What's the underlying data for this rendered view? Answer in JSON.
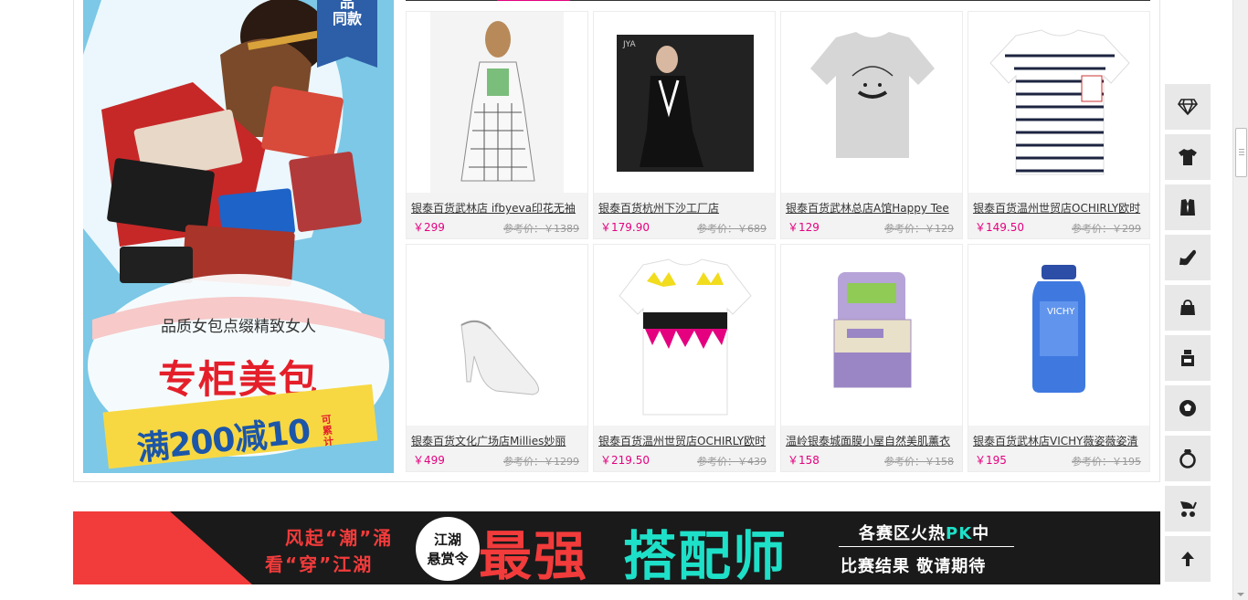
{
  "promo": {
    "badge_line1": "品",
    "badge_line2": "同款",
    "subtitle": "品质女包点缀精致女人",
    "title": "专柜美包",
    "deal": "满200减10",
    "deal_tag": "可累计"
  },
  "products": [
    {
      "name": "银泰百货武林店 ifbyeva印花无袖",
      "price": "￥299",
      "ref_price": "参考价：￥1389"
    },
    {
      "name": "银泰百货杭州下沙工厂店",
      "price": "￥179.90",
      "ref_price": "参考价：￥689"
    },
    {
      "name": "银泰百货武林总店A馆Happy Tee",
      "price": "￥129",
      "ref_price": "参考价：￥129"
    },
    {
      "name": "银泰百货温州世贸店OCHIRLY欧时",
      "price": "￥149.50",
      "ref_price": "参考价：￥299"
    },
    {
      "name": "银泰百货文化广场店Millies妙丽",
      "price": "￥499",
      "ref_price": "参考价：￥1299"
    },
    {
      "name": "银泰百货温州世贸店OCHIRLY欧时",
      "price": "￥219.50",
      "ref_price": "参考价：￥439"
    },
    {
      "name": "温岭银泰城面膜小屋自然美肌薰衣",
      "price": "￥158",
      "ref_price": "参考价：￥158"
    },
    {
      "name": "银泰百货武林店VICHY薇姿薇姿清",
      "price": "￥195",
      "ref_price": "参考价：￥195"
    }
  ],
  "banner": {
    "slogan1": "风起“潮”涌",
    "slogan2": "看“穿”江湖",
    "circle1": "江湖",
    "circle2": "悬赏令",
    "big1": "最强",
    "big2": "搭配师",
    "right1_pre": "各赛区火热",
    "right1_pk": "PK",
    "right1_post": "中",
    "right2": "比赛结果  敬请期待"
  },
  "sidenav": [
    {
      "icon": "diamond-icon"
    },
    {
      "icon": "tshirt-icon"
    },
    {
      "icon": "suit-icon"
    },
    {
      "icon": "high-heel-icon"
    },
    {
      "icon": "handbag-icon"
    },
    {
      "icon": "cosmetics-icon"
    },
    {
      "icon": "soccer-ball-icon"
    },
    {
      "icon": "ring-icon"
    },
    {
      "icon": "baby-stroller-icon"
    },
    {
      "icon": "back-to-top-icon"
    }
  ],
  "colors": {
    "accent": "#e4007f",
    "banner_red": "#f23b3b",
    "banner_cyan": "#1ee0c8",
    "promo_blue": "#7cc8e6"
  }
}
